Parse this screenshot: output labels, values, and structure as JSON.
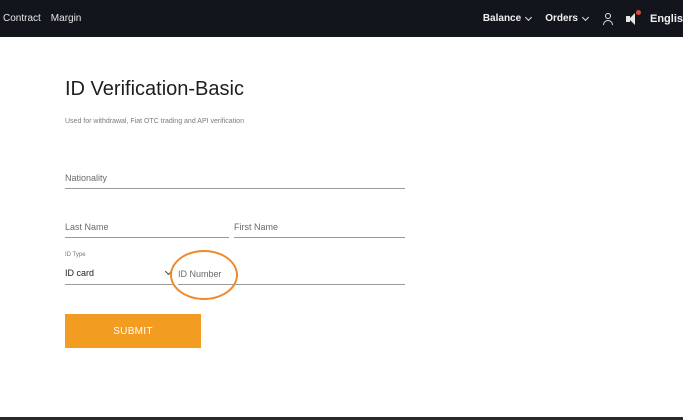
{
  "topbar": {
    "left_items": [
      "Contract",
      "Margin"
    ],
    "balance_label": "Balance",
    "orders_label": "Orders",
    "language_label": "Englis",
    "background_color": "#12161c",
    "notification_dot_color": "#e0463a"
  },
  "page": {
    "title": "ID Verification-Basic",
    "subtitle": "Used for withdrawal, Fiat OTC trading and API verification"
  },
  "form": {
    "nationality_placeholder": "Nationality",
    "last_name_placeholder": "Last Name",
    "first_name_placeholder": "First Name",
    "id_type_label": "ID Type",
    "id_type_value": "ID card",
    "id_number_placeholder": "ID Number",
    "submit_label": "SUBMIT",
    "submit_color": "#f39c22",
    "highlight_circle_color": "#ef8a2c"
  }
}
